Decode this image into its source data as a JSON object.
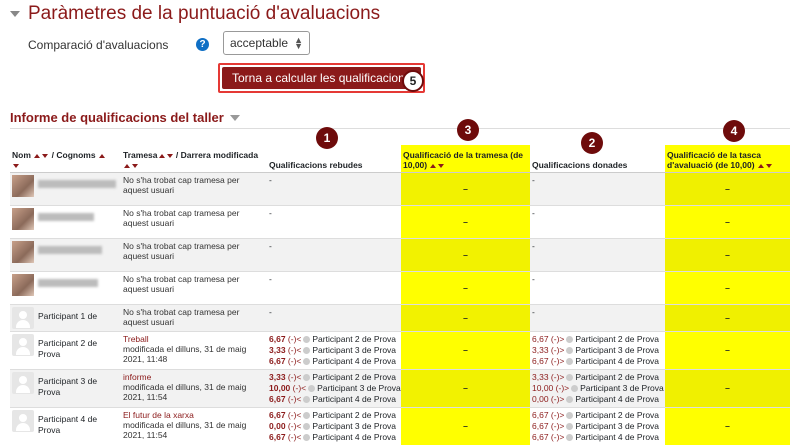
{
  "header": {
    "title": "Paràmetres de la puntuació d'avaluacions"
  },
  "comparison": {
    "label": "Comparació d'avaluacions",
    "value": "acceptable",
    "help": "?"
  },
  "recalc_button": {
    "label": "Torna a calcular les qualificacions"
  },
  "callouts": [
    "1",
    "2",
    "3",
    "4",
    "5"
  ],
  "report": {
    "title": "Informe de qualificacions del taller"
  },
  "columns": {
    "name": "Nom",
    "surname": "/ Cognoms",
    "submission": "Tramesa",
    "last_modified": "/ Darrera modificada",
    "received": "Qualificacions rebudes",
    "submission_grade": "Qualificació de la tramesa (de 10,00)",
    "given": "Qualificacions donades",
    "assessment_grade": "Qualificació de la tasca d'avaluació (de 10,00)"
  },
  "rows": [
    {
      "name": "",
      "submission": "No s'ha trobat cap tramesa per aquest usuari",
      "received": "-",
      "sub_grade": "–",
      "given": "-",
      "assess_grade": "–"
    },
    {
      "name": "",
      "submission": "No s'ha trobat cap tramesa per aquest usuari",
      "received": "-",
      "sub_grade": "–",
      "given": "-",
      "assess_grade": "–"
    },
    {
      "name": "",
      "submission": "No s'ha trobat cap tramesa per aquest usuari",
      "received": "-",
      "sub_grade": "–",
      "given": "-",
      "assess_grade": "–"
    },
    {
      "name": "",
      "submission": "No s'ha trobat cap tramesa per aquest usuari",
      "received": "-",
      "sub_grade": "–",
      "given": "-",
      "assess_grade": "–"
    },
    {
      "name": "Participant 1 de",
      "submission": "No s'ha trobat cap tramesa per aquest usuari",
      "received": "-",
      "sub_grade": "–",
      "given": "-",
      "assess_grade": "–"
    },
    {
      "name": "Participant 2 de Prova",
      "sub_title": "Treball",
      "sub_date": "modificada el dilluns, 31 de maig 2021, 11:48",
      "received": [
        {
          "g": "6,67",
          "s": "(-)<",
          "who": "Participant 2 de Prova"
        },
        {
          "g": "3,33",
          "s": "(-)<",
          "who": "Participant 3 de Prova"
        },
        {
          "g": "6,67",
          "s": "(-)<",
          "who": "Participant 4 de Prova"
        }
      ],
      "sub_grade": "–",
      "given": [
        {
          "g": "6,67",
          "s": "(-)>",
          "who": "Participant 2 de Prova"
        },
        {
          "g": "3,33",
          "s": "(-)>",
          "who": "Participant 3 de Prova"
        },
        {
          "g": "6,67",
          "s": "(-)>",
          "who": "Participant 4 de Prova"
        }
      ],
      "assess_grade": "–"
    },
    {
      "name": "Participant 3 de Prova",
      "sub_title": "informe",
      "sub_date": "modificada el dilluns, 31 de maig 2021, 11:54",
      "received": [
        {
          "g": "3,33",
          "s": "(-)<",
          "who": "Participant 2 de Prova"
        },
        {
          "g": "10,00",
          "s": "(-)<",
          "who": "Participant 3 de Prova"
        },
        {
          "g": "6,67",
          "s": "(-)<",
          "who": "Participant 4 de Prova"
        }
      ],
      "sub_grade": "–",
      "given": [
        {
          "g": "3,33",
          "s": "(-)>",
          "who": "Participant 2 de Prova"
        },
        {
          "g": "10,00",
          "s": "(-)>",
          "who": "Participant 3 de Prova"
        },
        {
          "g": "0,00",
          "s": "(-)>",
          "who": "Participant 4 de Prova"
        }
      ],
      "assess_grade": "–"
    },
    {
      "name": "Participant 4 de Prova",
      "sub_title": "El futur de la xarxa",
      "sub_date": "modificada el dilluns, 31 de maig 2021, 11:54",
      "received": [
        {
          "g": "6,67",
          "s": "(-)<",
          "who": "Participant 2 de Prova"
        },
        {
          "g": "0,00",
          "s": "(-)<",
          "who": "Participant 3 de Prova"
        },
        {
          "g": "6,67",
          "s": "(-)<",
          "who": "Participant 4 de Prova"
        }
      ],
      "sub_grade": "–",
      "given": [
        {
          "g": "6,67",
          "s": "(-)>",
          "who": "Participant 2 de Prova"
        },
        {
          "g": "6,67",
          "s": "(-)>",
          "who": "Participant 3 de Prova"
        },
        {
          "g": "6,67",
          "s": "(-)>",
          "who": "Participant 4 de Prova"
        }
      ],
      "assess_grade": "–"
    }
  ]
}
